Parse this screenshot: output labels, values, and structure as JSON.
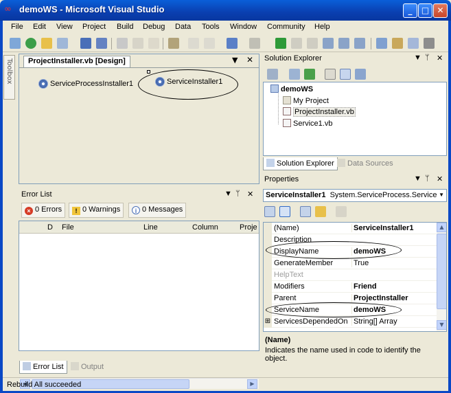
{
  "window": {
    "title": "demoWS - Microsoft Visual Studio",
    "min": "_",
    "max": "□",
    "close": "✕"
  },
  "menu": [
    "File",
    "Edit",
    "View",
    "Project",
    "Build",
    "Debug",
    "Data",
    "Tools",
    "Window",
    "Community",
    "Help"
  ],
  "toolbox": {
    "label": "Toolbox"
  },
  "designer": {
    "tab": "ProjectInstaller.vb [Design]",
    "components": [
      "ServiceProcessInstaller1",
      "ServiceInstaller1"
    ],
    "pin": "▼",
    "close": "✕"
  },
  "errorlist": {
    "title": "Error List",
    "pin": "▼",
    "autohide": "ᛘ",
    "close": "✕",
    "filters": [
      "0 Errors",
      "0 Warnings",
      "0 Messages"
    ],
    "columns": [
      "",
      "D",
      "File",
      "Line",
      "Column",
      "Proje"
    ],
    "tabs": [
      "Error List",
      "Output"
    ]
  },
  "solution_explorer": {
    "title": "Solution Explorer",
    "pin": "▼",
    "autohide": "ᛘ",
    "close": "✕",
    "tree": [
      "demoWS",
      "My Project",
      "ProjectInstaller.vb",
      "Service1.vb"
    ],
    "tabs": [
      "Solution Explorer",
      "Data Sources"
    ]
  },
  "properties": {
    "title": "Properties",
    "pin": "▼",
    "autohide": "ᛘ",
    "close": "✕",
    "object_name": "ServiceInstaller1",
    "object_type": "System.ServiceProcess.Service",
    "rows": [
      {
        "name": "(Name)",
        "value": "ServiceInstaller1",
        "bold": true
      },
      {
        "name": "Description",
        "value": "",
        "bold": false
      },
      {
        "name": "DisplayName",
        "value": "demoWS",
        "bold": true
      },
      {
        "name": "GenerateMember",
        "value": "True",
        "bold": false
      },
      {
        "name": "HelpText",
        "value": "",
        "bold": false,
        "disabled": true
      },
      {
        "name": "Modifiers",
        "value": "Friend",
        "bold": true
      },
      {
        "name": "Parent",
        "value": "ProjectInstaller",
        "bold": true
      },
      {
        "name": "ServiceName",
        "value": "demoWS",
        "bold": true
      },
      {
        "name": "ServicesDependedOn",
        "value": "String[] Array",
        "bold": false
      }
    ],
    "desc_title": "(Name)",
    "desc_text": "Indicates the name used in code to identify the object."
  },
  "status": {
    "text": "Rebuild All succeeded"
  }
}
